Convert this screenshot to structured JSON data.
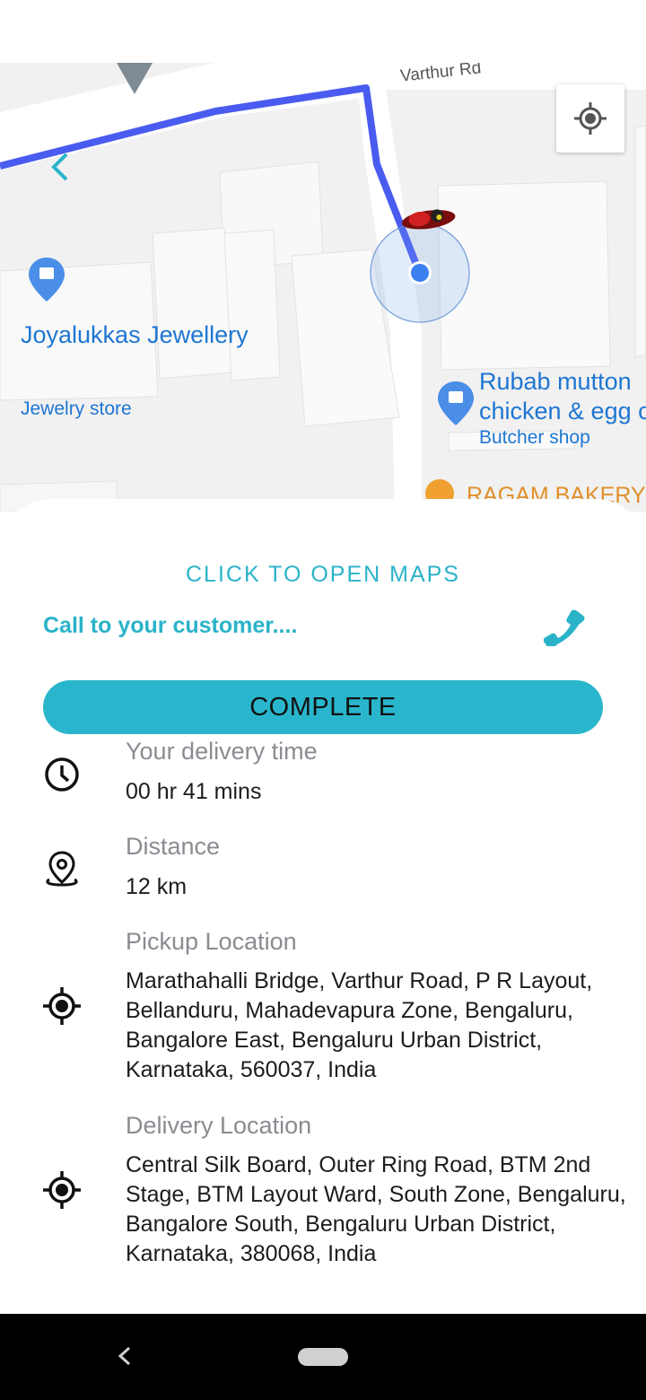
{
  "map": {
    "road_label": "Varthur Rd",
    "places": [
      {
        "name": "Joyalukkas Jewellery",
        "category": "Jewelry store"
      },
      {
        "name_line1": "Rubab mutton",
        "name_line2": "chicken & egg c",
        "category": "Butcher shop"
      },
      {
        "name": "RAGAM BAKERY"
      }
    ],
    "route_color": "#4a5cf0",
    "accent_color": "#2ab3c9"
  },
  "sheet": {
    "open_maps_label": "CLICK TO OPEN MAPS",
    "call_label": "Call to your customer....",
    "complete_label": "COMPLETE",
    "delivery_time": {
      "label": "Your delivery time",
      "value": "00 hr 41 mins"
    },
    "distance": {
      "label": "Distance",
      "value": "12 km"
    },
    "pickup": {
      "label": "Pickup Location",
      "value": "Marathahalli Bridge, Varthur Road, P R Layout, Bellanduru, Mahadevapura Zone, Bengaluru, Bangalore East, Bengaluru Urban District, Karnataka, 560037, India"
    },
    "delivery": {
      "label": "Delivery Location",
      "value": "Central Silk Board, Outer Ring Road, BTM 2nd Stage, BTM Layout Ward, South Zone, Bengaluru, Bangalore South, Bengaluru Urban District, Karnataka, 380068, India"
    }
  },
  "icons": {
    "locate": "my-location-icon",
    "back": "chevron-left-icon",
    "phone": "phone-icon",
    "clock": "clock-icon",
    "distance": "map-pin-icon",
    "pickup": "gps-target-icon",
    "delivery": "gps-target-icon"
  }
}
